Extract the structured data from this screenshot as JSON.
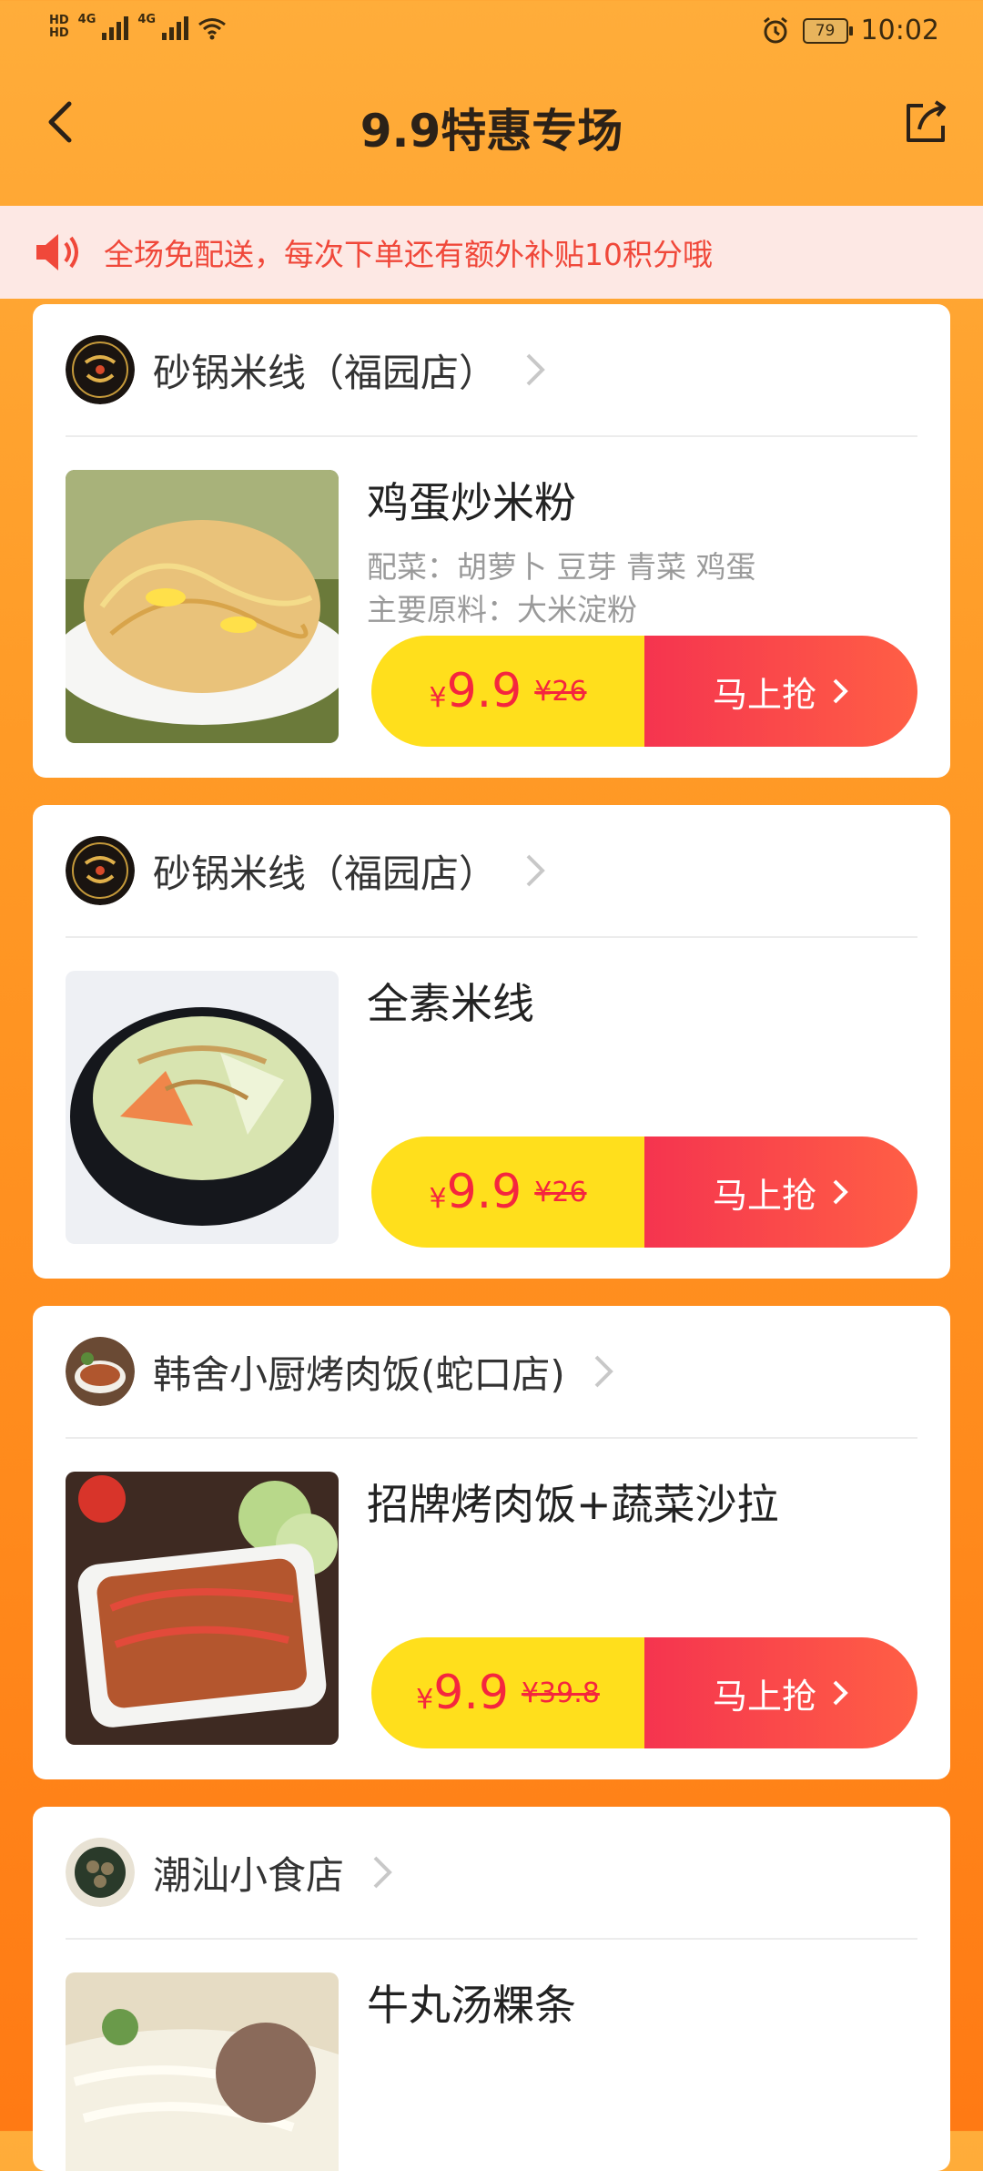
{
  "status_bar": {
    "network_left": "4G",
    "network_right": "4G",
    "battery": "79",
    "time": "10:02"
  },
  "header": {
    "title": "9.9特惠专场"
  },
  "notice": {
    "text": "全场免配送，每次下单还有额外补贴10积分哦"
  },
  "cards": [
    {
      "shop": "砂锅米线（福园店）",
      "dish": "鸡蛋炒米粉",
      "sub1": "配菜：胡萝卜 豆芽 青菜 鸡蛋",
      "sub2": "主要原料：大米淀粉",
      "price_yen": "¥",
      "price_now": "9.9",
      "price_old": "¥26",
      "grab": "马上抢"
    },
    {
      "shop": "砂锅米线（福园店）",
      "dish": "全素米线",
      "price_yen": "¥",
      "price_now": "9.9",
      "price_old": "¥26",
      "grab": "马上抢"
    },
    {
      "shop": "韩舍小厨烤肉饭(蛇口店)",
      "dish": "招牌烤肉饭+蔬菜沙拉",
      "price_yen": "¥",
      "price_now": "9.9",
      "price_old": "¥39.8",
      "grab": "马上抢"
    },
    {
      "shop": "潮汕小食店",
      "dish": "牛丸汤粿条"
    }
  ],
  "colors": {
    "accent_red": "#f5263e",
    "price_yellow": "#ffdf1c",
    "notice_bg": "#fde8e4",
    "bg_orange": "#ff9a26"
  }
}
